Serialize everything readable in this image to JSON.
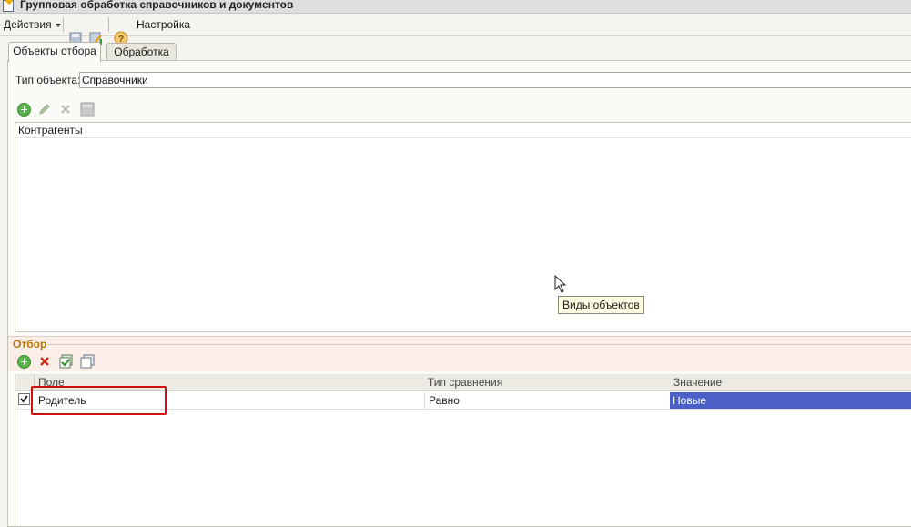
{
  "window": {
    "title": "Групповая обработка справочников и документов"
  },
  "toolbar": {
    "actions_label": "Действия",
    "settings_label": "Настройка"
  },
  "tabs": [
    {
      "label": "Объекты отбора",
      "active": true
    },
    {
      "label": "Обработка",
      "active": false
    }
  ],
  "object_type": {
    "label": "Тип объекта:",
    "value": "Справочники"
  },
  "objects_list": {
    "items": [
      "Контрагенты"
    ]
  },
  "tooltip": {
    "text": "Виды объектов"
  },
  "filter": {
    "section_label": "Отбор",
    "columns": [
      "Поле",
      "Тип сравнения",
      "Значение"
    ],
    "rows": [
      {
        "checked": true,
        "field": "Родитель",
        "comparison": "Равно",
        "value": "Новые"
      }
    ]
  },
  "colors": {
    "selection": "#4a5fc7",
    "highlight_box": "#d01010",
    "section_label": "#b87400"
  }
}
